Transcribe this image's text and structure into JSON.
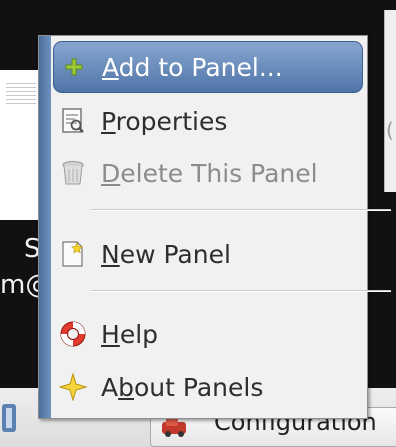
{
  "menu": {
    "items": [
      {
        "pre": "",
        "mn": "A",
        "post": "dd to Panel...",
        "icon": "add-icon",
        "state": "highlighted"
      },
      {
        "pre": "",
        "mn": "P",
        "post": "roperties",
        "icon": "properties-icon",
        "state": "normal"
      },
      {
        "pre": "",
        "mn": "D",
        "post": "elete This Panel",
        "icon": "trash-icon",
        "state": "disabled"
      },
      {
        "pre": "",
        "mn": "N",
        "post": "ew Panel",
        "icon": "new-panel-icon",
        "state": "normal"
      },
      {
        "pre": "",
        "mn": "H",
        "post": "elp",
        "icon": "help-icon",
        "state": "normal"
      },
      {
        "pre": "A",
        "mn": "b",
        "post": "out Panels",
        "icon": "about-star-icon",
        "state": "normal"
      }
    ]
  },
  "background": {
    "text_s": "S",
    "text_m": "m@",
    "right_char": "(",
    "taskbar_label": "Configuration"
  },
  "colors": {
    "highlight": "#5b80b2",
    "menu_bg": "#f1f1f1",
    "desktop": "#111111"
  }
}
